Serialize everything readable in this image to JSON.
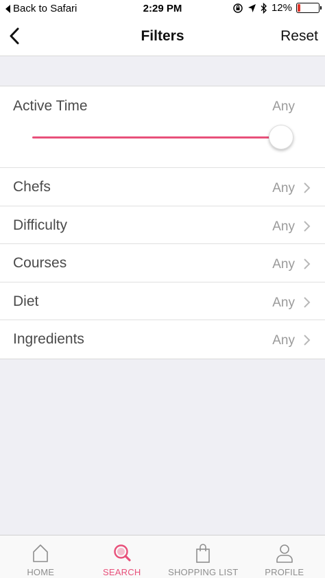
{
  "status_bar": {
    "back_text": "Back to Safari",
    "time": "2:29 PM",
    "battery_text": "12%",
    "battery_level": 0.12,
    "battery_color": "#e0362c"
  },
  "nav": {
    "title": "Filters",
    "reset_label": "Reset"
  },
  "filters": {
    "active_time": {
      "label": "Active Time",
      "value": "Any",
      "slider_level": 1.0
    },
    "rows": [
      {
        "label": "Chefs",
        "value": "Any"
      },
      {
        "label": "Difficulty",
        "value": "Any"
      },
      {
        "label": "Courses",
        "value": "Any"
      },
      {
        "label": "Diet",
        "value": "Any"
      },
      {
        "label": "Ingredients",
        "value": "Any"
      }
    ]
  },
  "tabs": [
    {
      "label": "HOME",
      "icon": "home-icon",
      "active": false
    },
    {
      "label": "SEARCH",
      "icon": "search-icon",
      "active": true
    },
    {
      "label": "SHOPPING LIST",
      "icon": "shopping-bag-icon",
      "active": false
    },
    {
      "label": "PROFILE",
      "icon": "profile-icon",
      "active": false
    }
  ],
  "colors": {
    "accent": "#e8507a",
    "inactive_tab": "#8e8e8e",
    "background": "#efeff4"
  }
}
